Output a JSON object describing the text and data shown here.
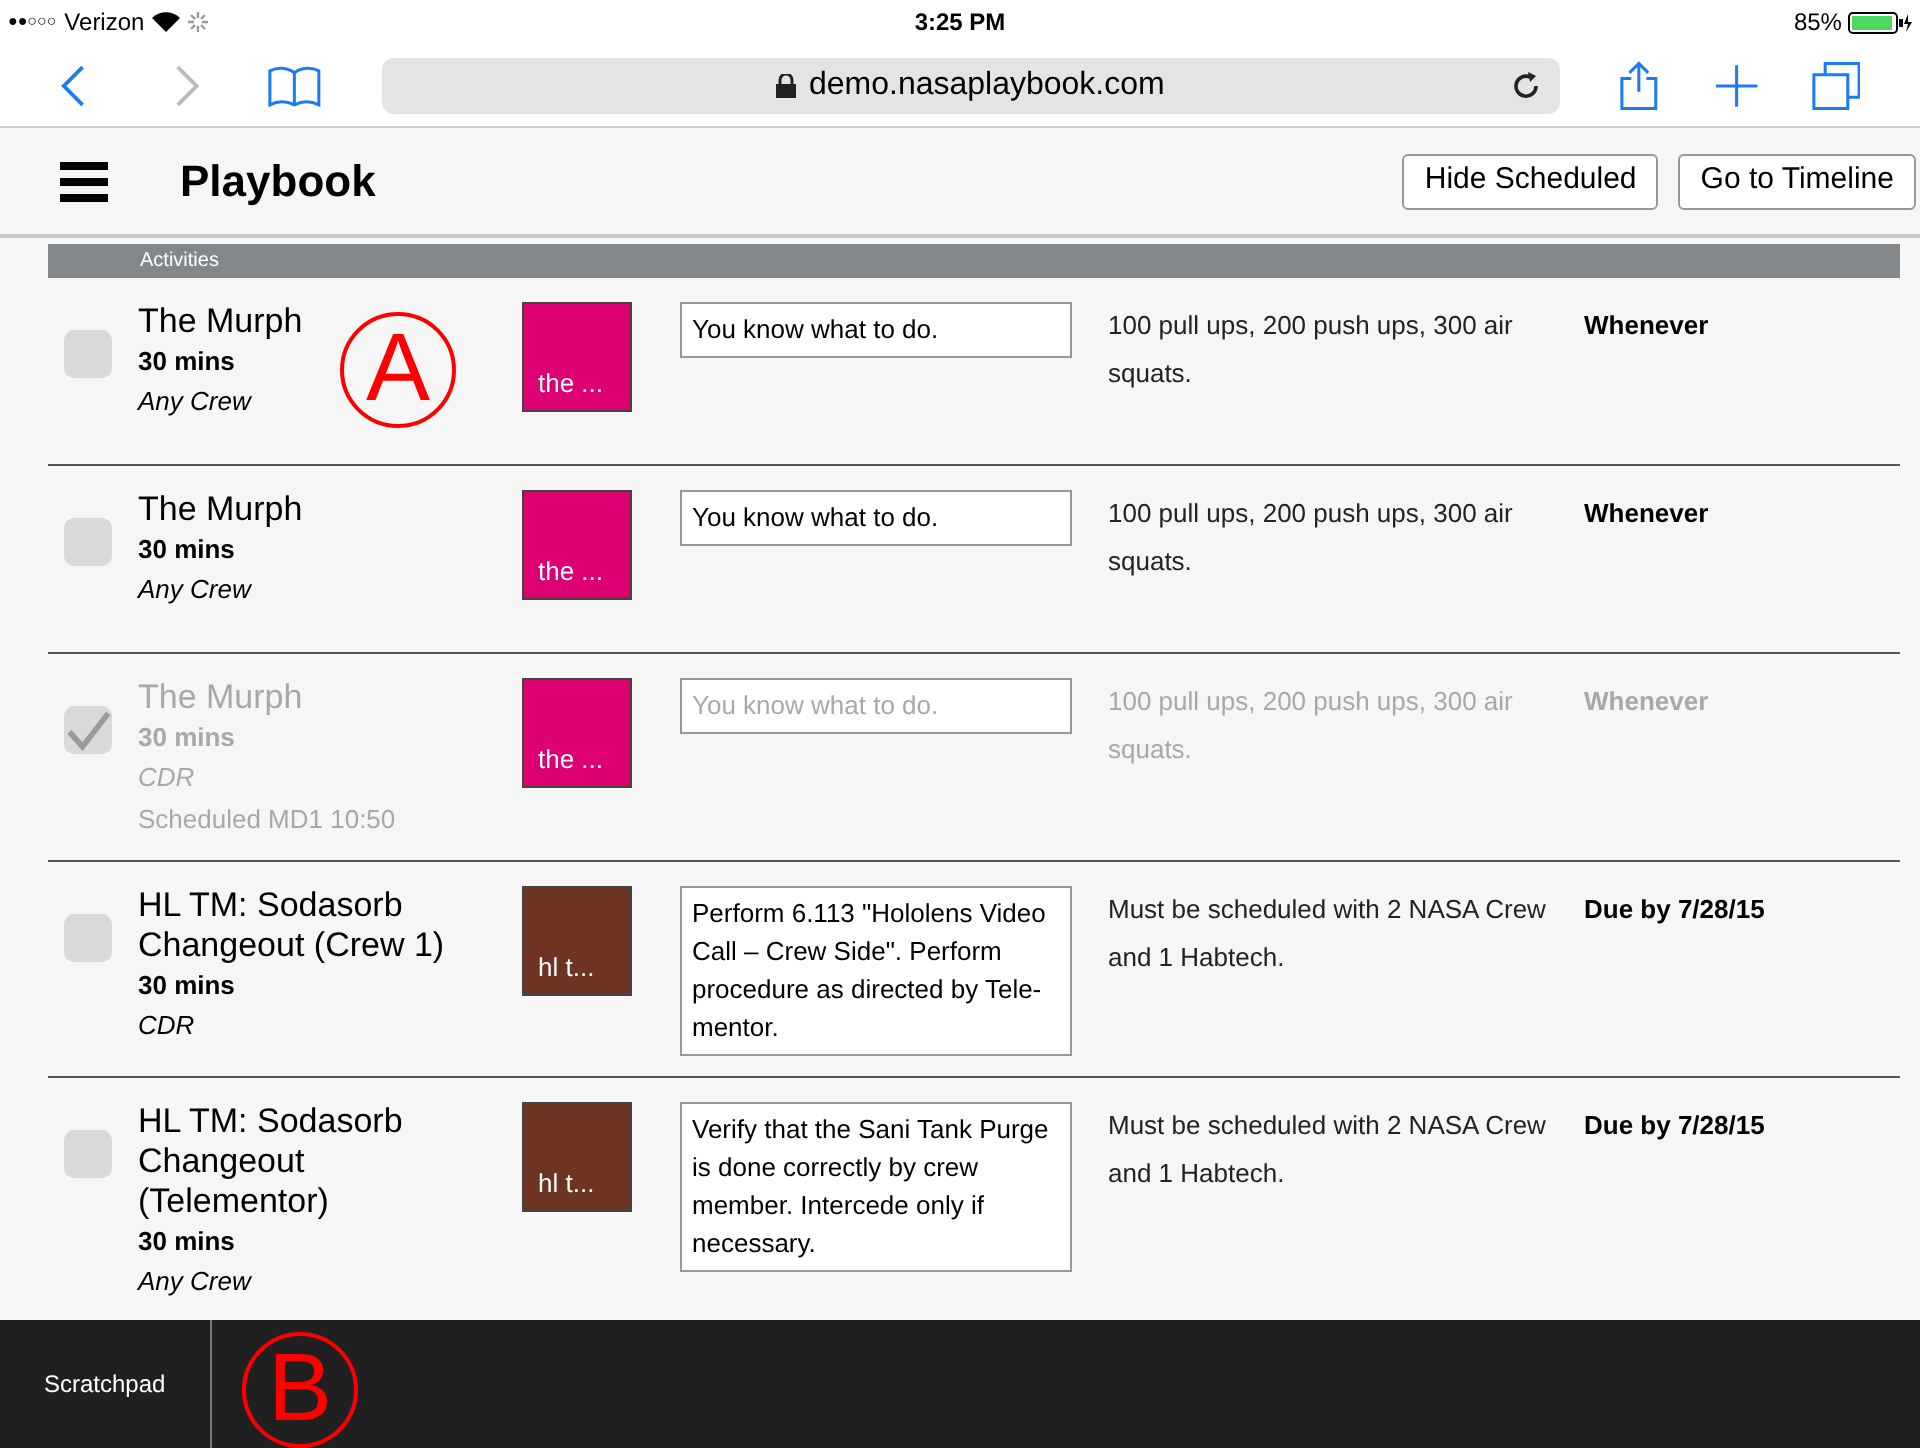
{
  "status_bar": {
    "signal": "●●○○○",
    "carrier": "Verizon",
    "time": "3:25 PM",
    "battery": "85%"
  },
  "browser": {
    "url": "demo.nasaplaybook.com"
  },
  "header": {
    "title": "Playbook",
    "buttons": [
      "Hide Scheduled",
      "Go to Timeline"
    ]
  },
  "section": {
    "title": "Activities"
  },
  "activities": [
    {
      "checked": false,
      "disabled": false,
      "title": "The Murph",
      "duration": "30 mins",
      "crew": "Any Crew",
      "color": "#dc0073",
      "tag": "the ...",
      "instruction": "You know what to do.",
      "notes": "100 pull ups, 200 push ups, 300 air squats.",
      "due": "Whenever"
    },
    {
      "checked": false,
      "disabled": false,
      "title": "The Murph",
      "duration": "30 mins",
      "crew": "Any Crew",
      "color": "#dc0073",
      "tag": "the ...",
      "instruction": "You know what to do.",
      "notes": "100 pull ups, 200 push ups, 300 air squats.",
      "due": "Whenever"
    },
    {
      "checked": true,
      "disabled": true,
      "title": "The Murph",
      "duration": "30 mins",
      "crew": "CDR",
      "scheduled": "Scheduled MD1 10:50",
      "color": "#dc0073",
      "tag": "the ...",
      "instruction": "You know what to do.",
      "notes": "100 pull ups, 200 push ups, 300 air squats.",
      "due": "Whenever"
    },
    {
      "checked": false,
      "disabled": false,
      "title": "HL TM: Sodasorb Changeout (Crew 1)",
      "duration": "30 mins",
      "crew": "CDR",
      "color": "#6e3423",
      "tag": "hl t...",
      "instruction": "Perform 6.113 \"Hololens Video Call – Crew Side\". Perform procedure as directed by Tele-mentor.",
      "notes": "Must be scheduled with 2 NASA Crew and 1 Habtech.",
      "due": "Due by 7/28/15"
    },
    {
      "checked": false,
      "disabled": false,
      "title": "HL TM: Sodasorb Changeout (Telementor)",
      "duration": "30 mins",
      "crew": "Any Crew",
      "color": "#6e3423",
      "tag": "hl t...",
      "instruction": "Verify that the Sani Tank Purge is done correctly by crew member. Intercede only if necessary.",
      "notes": "Must be scheduled with 2 NASA Crew and 1 Habtech.",
      "due": "Due by 7/28/15"
    }
  ],
  "bottom_bar": {
    "tab": "Scratchpad"
  },
  "annotations": [
    "A",
    "B"
  ]
}
